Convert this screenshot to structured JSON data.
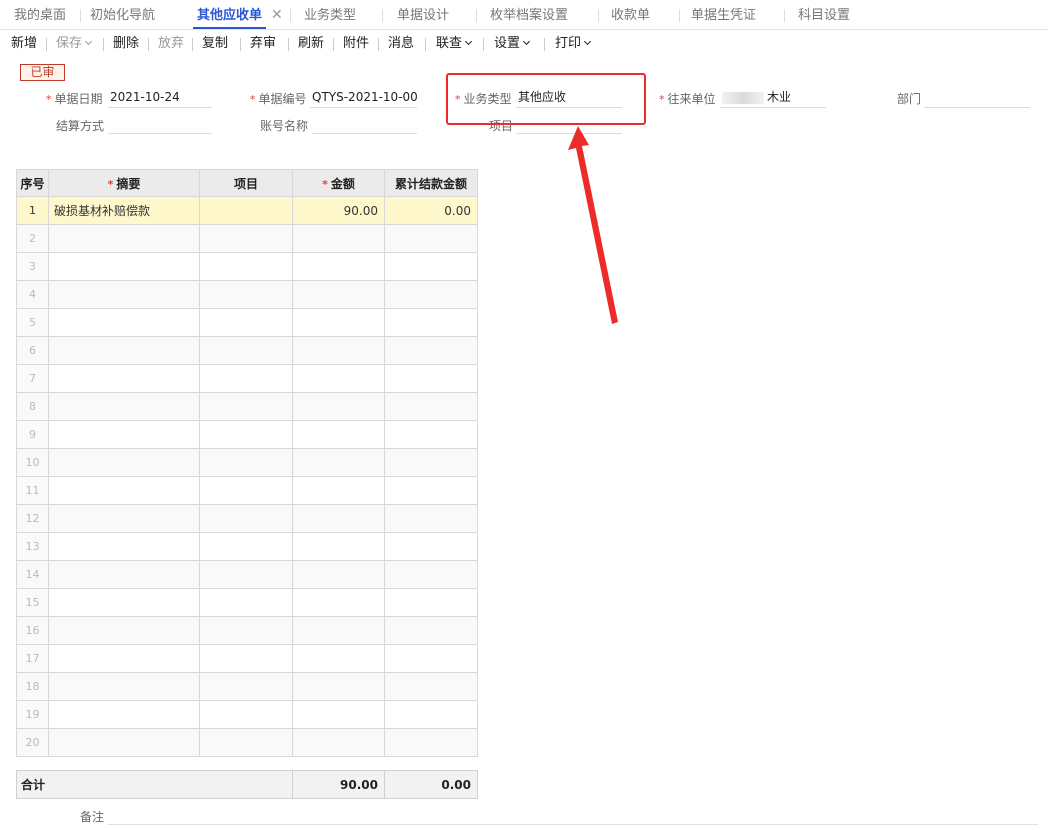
{
  "tabs": [
    {
      "label": "我的桌面"
    },
    {
      "label": "初始化导航"
    },
    {
      "label": "其他应收单",
      "active": true
    },
    {
      "label": "业务类型"
    },
    {
      "label": "单据设计"
    },
    {
      "label": "枚举档案设置"
    },
    {
      "label": "收款单"
    },
    {
      "label": "单据生凭证"
    },
    {
      "label": "科目设置"
    }
  ],
  "toolbar": {
    "new": "新增",
    "save": "保存",
    "delete": "删除",
    "discard": "放弃",
    "copy": "复制",
    "unaudit": "弃审",
    "refresh": "刷新",
    "attach": "附件",
    "message": "消息",
    "link_query": "联查",
    "settings": "设置",
    "print": "打印"
  },
  "status_stamp": "已审",
  "form": {
    "date_label": "单据日期",
    "date_value": "2021-10-24",
    "docno_label": "单据编号",
    "docno_value": "QTYS-2021-10-00...",
    "biztype_label": "业务类型",
    "biztype_value": "其他应收",
    "partner_label": "往来单位",
    "partner_value": "木业",
    "dept_label": "部门",
    "settle_label": "结算方式",
    "account_label": "账号名称",
    "project_label": "项目"
  },
  "grid": {
    "headers": [
      "序号",
      "摘要",
      "项目",
      "金额",
      "累计结款金额"
    ],
    "rows": [
      {
        "idx": "1",
        "summary": "破损基材补赔偿款",
        "project": "",
        "amount": "90.00",
        "settled": "0.00"
      },
      {
        "idx": "2",
        "summary": "",
        "project": "",
        "amount": "",
        "settled": ""
      },
      {
        "idx": "3",
        "summary": "",
        "project": "",
        "amount": "",
        "settled": ""
      },
      {
        "idx": "4",
        "summary": "",
        "project": "",
        "amount": "",
        "settled": ""
      },
      {
        "idx": "5",
        "summary": "",
        "project": "",
        "amount": "",
        "settled": ""
      },
      {
        "idx": "6",
        "summary": "",
        "project": "",
        "amount": "",
        "settled": ""
      },
      {
        "idx": "7",
        "summary": "",
        "project": "",
        "amount": "",
        "settled": ""
      },
      {
        "idx": "8",
        "summary": "",
        "project": "",
        "amount": "",
        "settled": ""
      },
      {
        "idx": "9",
        "summary": "",
        "project": "",
        "amount": "",
        "settled": ""
      },
      {
        "idx": "10",
        "summary": "",
        "project": "",
        "amount": "",
        "settled": ""
      },
      {
        "idx": "11",
        "summary": "",
        "project": "",
        "amount": "",
        "settled": ""
      },
      {
        "idx": "12",
        "summary": "",
        "project": "",
        "amount": "",
        "settled": ""
      },
      {
        "idx": "13",
        "summary": "",
        "project": "",
        "amount": "",
        "settled": ""
      },
      {
        "idx": "14",
        "summary": "",
        "project": "",
        "amount": "",
        "settled": ""
      },
      {
        "idx": "15",
        "summary": "",
        "project": "",
        "amount": "",
        "settled": ""
      },
      {
        "idx": "16",
        "summary": "",
        "project": "",
        "amount": "",
        "settled": ""
      },
      {
        "idx": "17",
        "summary": "",
        "project": "",
        "amount": "",
        "settled": ""
      },
      {
        "idx": "18",
        "summary": "",
        "project": "",
        "amount": "",
        "settled": ""
      },
      {
        "idx": "19",
        "summary": "",
        "project": "",
        "amount": "",
        "settled": ""
      },
      {
        "idx": "20",
        "summary": "",
        "project": "",
        "amount": "",
        "settled": ""
      }
    ]
  },
  "totals": {
    "label": "合计",
    "amount": "90.00",
    "settled": "0.00"
  },
  "note_label": "备注",
  "colors": {
    "accent": "#2b57d6",
    "required": "#e23c3c",
    "highlight": "#ee2b2b",
    "selected_row": "#fff8cc"
  }
}
